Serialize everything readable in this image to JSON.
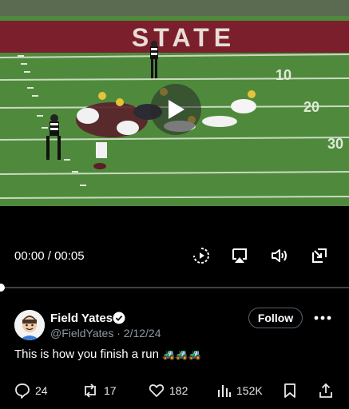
{
  "video": {
    "banner_text": "STATE",
    "yard_numbers": [
      "10",
      "20",
      "30"
    ],
    "current_time": "00:00",
    "separator": " / ",
    "duration": "00:05",
    "progress": 0
  },
  "author": {
    "name": "Field Yates",
    "handle": "@FieldYates",
    "date_sep": " · ",
    "date": "2/12/24",
    "verified": true,
    "follow_label": "Follow"
  },
  "tweet": {
    "text": "This is how you finish a run",
    "emoji": "🚜🚜🚜"
  },
  "actions": {
    "replies": "24",
    "reposts": "17",
    "likes": "182",
    "views": "152K"
  },
  "colors": {
    "field": "#4f8a3c",
    "banner": "#7a1f2b",
    "accent_verified": "#1d9bf0"
  }
}
